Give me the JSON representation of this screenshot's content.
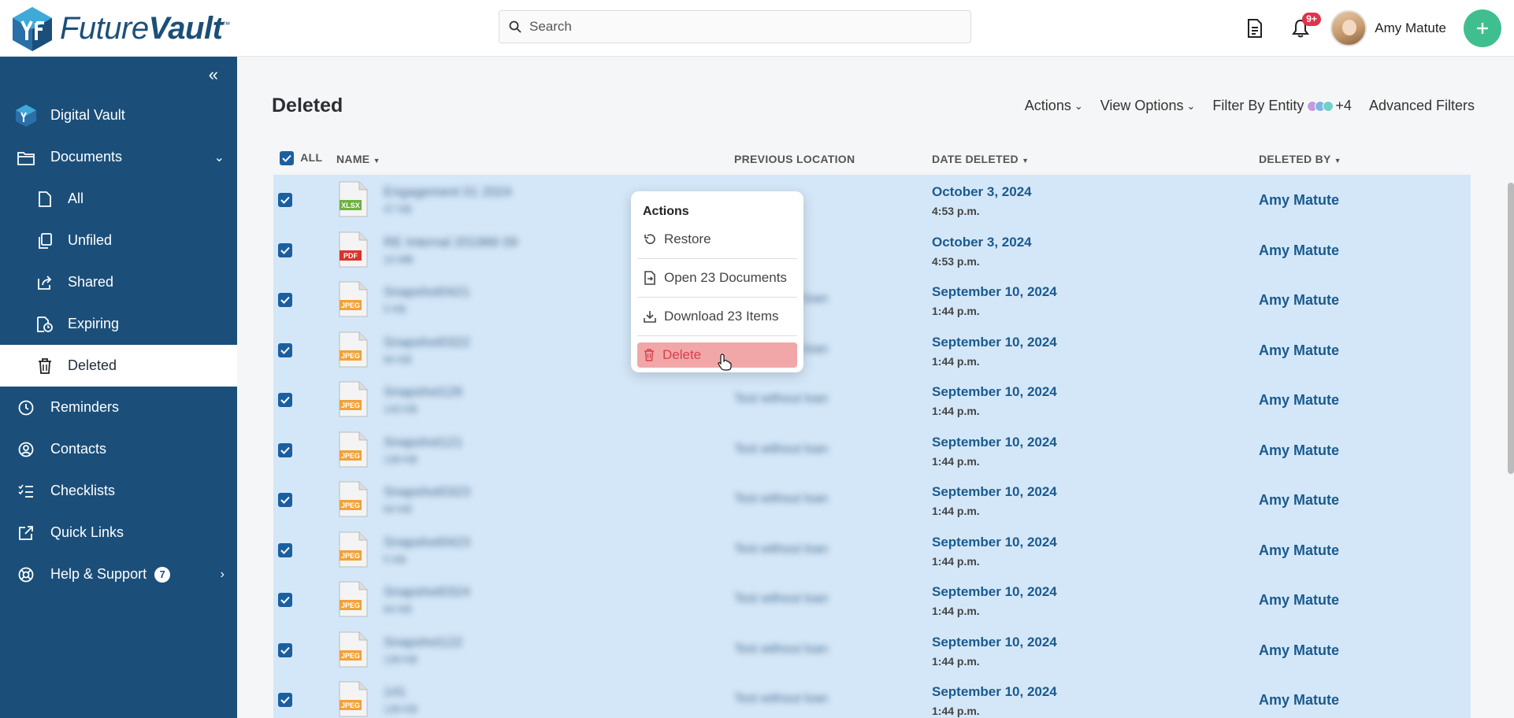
{
  "app": {
    "brand_light": "Future",
    "brand_bold": "Vault",
    "brand_tm": "™"
  },
  "search": {
    "placeholder": "Search",
    "value": ""
  },
  "header": {
    "notifications_badge": "9+",
    "user_name": "Amy Matute"
  },
  "sidebar": {
    "items": [
      {
        "label": "Digital Vault",
        "icon": "vault-logo-icon"
      },
      {
        "label": "Documents",
        "icon": "folder-icon"
      },
      {
        "label": "All",
        "icon": "file-icon"
      },
      {
        "label": "Unfiled",
        "icon": "copy-icon"
      },
      {
        "label": "Shared",
        "icon": "share-icon"
      },
      {
        "label": "Expiring",
        "icon": "expiring-icon"
      },
      {
        "label": "Deleted",
        "icon": "trash-icon"
      },
      {
        "label": "Reminders",
        "icon": "clock-icon"
      },
      {
        "label": "Contacts",
        "icon": "contact-icon"
      },
      {
        "label": "Checklists",
        "icon": "checklist-icon"
      },
      {
        "label": "Quick Links",
        "icon": "external-link-icon"
      },
      {
        "label": "Help & Support",
        "icon": "lifebuoy-icon",
        "count": "7"
      }
    ]
  },
  "main": {
    "title": "Deleted",
    "toolbar": {
      "actions": "Actions",
      "view_options": "View Options",
      "filter_by_entity": "Filter By Entity",
      "entity_more": "+4",
      "advanced_filters": "Advanced Filters"
    },
    "columns": {
      "all": "ALL",
      "name": "NAME",
      "previous_location": "PREVIOUS LOCATION",
      "date_deleted": "DATE DELETED",
      "deleted_by": "DELETED BY"
    },
    "rows": [
      {
        "type": "XLSX",
        "name": "Engagement 01 2024",
        "size": "47 KB",
        "prev": "",
        "date": "October 3, 2024",
        "time": "4:53 p.m.",
        "by": "Amy Matute"
      },
      {
        "type": "PDF",
        "name": "RE Internal 201966 09",
        "size": "10 MB",
        "prev": "",
        "date": "October 3, 2024",
        "time": "4:53 p.m.",
        "by": "Amy Matute"
      },
      {
        "type": "JPEG",
        "name": "Snapshot0421",
        "size": "5 KB",
        "prev": "Test without loan",
        "date": "September 10, 2024",
        "time": "1:44 p.m.",
        "by": "Amy Matute"
      },
      {
        "type": "JPEG",
        "name": "Snapshot0322",
        "size": "64 KB",
        "prev": "Test without loan",
        "date": "September 10, 2024",
        "time": "1:44 p.m.",
        "by": "Amy Matute"
      },
      {
        "type": "JPEG",
        "name": "Snapshot126",
        "size": "143 KB",
        "prev": "Test without loan",
        "date": "September 10, 2024",
        "time": "1:44 p.m.",
        "by": "Amy Matute"
      },
      {
        "type": "JPEG",
        "name": "Snapshot121",
        "size": "139 KB",
        "prev": "Test without loan",
        "date": "September 10, 2024",
        "time": "1:44 p.m.",
        "by": "Amy Matute"
      },
      {
        "type": "JPEG",
        "name": "Snapshot0323",
        "size": "64 KB",
        "prev": "Test without loan",
        "date": "September 10, 2024",
        "time": "1:44 p.m.",
        "by": "Amy Matute"
      },
      {
        "type": "JPEG",
        "name": "Snapshot0423",
        "size": "5 KB",
        "prev": "Test without loan",
        "date": "September 10, 2024",
        "time": "1:44 p.m.",
        "by": "Amy Matute"
      },
      {
        "type": "JPEG",
        "name": "Snapshot0324",
        "size": "64 KB",
        "prev": "Test without loan",
        "date": "September 10, 2024",
        "time": "1:44 p.m.",
        "by": "Amy Matute"
      },
      {
        "type": "JPEG",
        "name": "Snapshot122",
        "size": "139 KB",
        "prev": "Test without loan",
        "date": "September 10, 2024",
        "time": "1:44 p.m.",
        "by": "Amy Matute"
      },
      {
        "type": "JPEG",
        "name": "141",
        "size": "139 KB",
        "prev": "Test without loan",
        "date": "September 10, 2024",
        "time": "1:44 p.m.",
        "by": "Amy Matute"
      }
    ]
  },
  "popup": {
    "title": "Actions",
    "restore": "Restore",
    "open": "Open 23 Documents",
    "download": "Download 23 Items",
    "delete": "Delete"
  },
  "colors": {
    "sidebar": "#1b4f7a",
    "accent_green": "#3fbf8f",
    "selected_row": "#d4e7f8",
    "link_blue": "#1b5a8e",
    "danger_bg": "#f1a7a8",
    "danger_text": "#d8404a",
    "xlsx": "#6cb33e",
    "pdf": "#d9342b",
    "jpeg": "#f0a23a"
  }
}
